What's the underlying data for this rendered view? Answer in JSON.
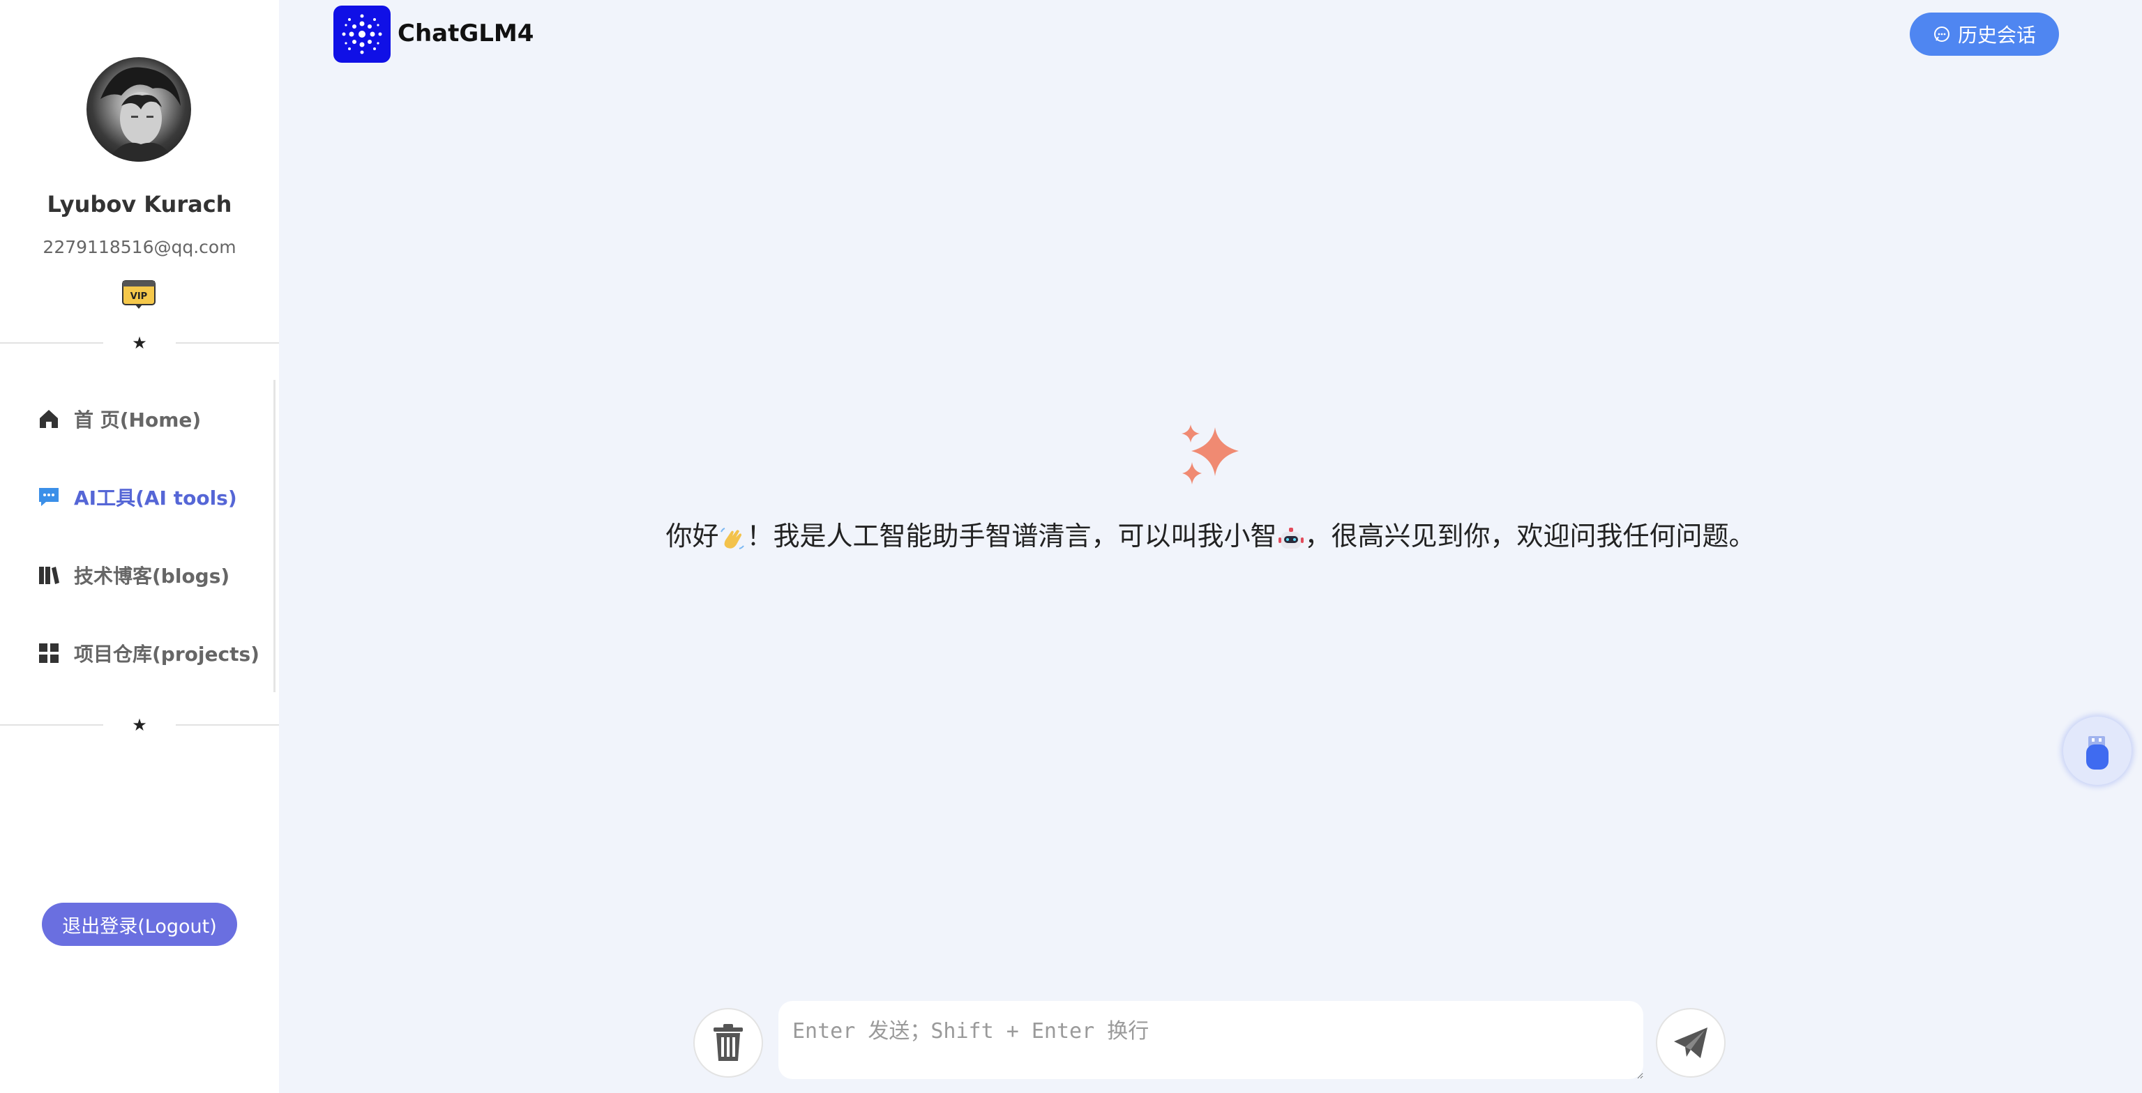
{
  "sidebar": {
    "user": {
      "name": "Lyubov Kurach",
      "email": "2279118516@qq.com",
      "badge_icon": "vip-badge-icon",
      "badge_text": "VIP"
    },
    "divider_icon": "star-icon",
    "nav": [
      {
        "label": "首 页(Home)",
        "icon": "home-icon",
        "active": false
      },
      {
        "label": "AI工具(AI tools)",
        "icon": "chat-icon",
        "active": true
      },
      {
        "label": "技术博客(blogs)",
        "icon": "books-icon",
        "active": false
      },
      {
        "label": "项目仓库(projects)",
        "icon": "grid-icon",
        "active": false
      }
    ],
    "logout_label": "退出登录(Logout)"
  },
  "header": {
    "app_title": "ChatGLM4",
    "history_label": "历史会话"
  },
  "welcome": {
    "part1": "你好",
    "part2": "！我是人工智能助手智谱清言，可以叫我小智",
    "part3": "，很高兴见到你，欢迎问我任何问题。",
    "emoji1": "waving-hand-icon",
    "emoji2": "robot-icon"
  },
  "composer": {
    "placeholder": "Enter 发送；Shift + Enter 换行",
    "value": ""
  },
  "colors": {
    "accent": "#4f86f1",
    "active_nav": "#5566d6",
    "logout_bg": "#6a6fe0",
    "sparkle": "#f08a72",
    "background": "#f1f4fb"
  }
}
